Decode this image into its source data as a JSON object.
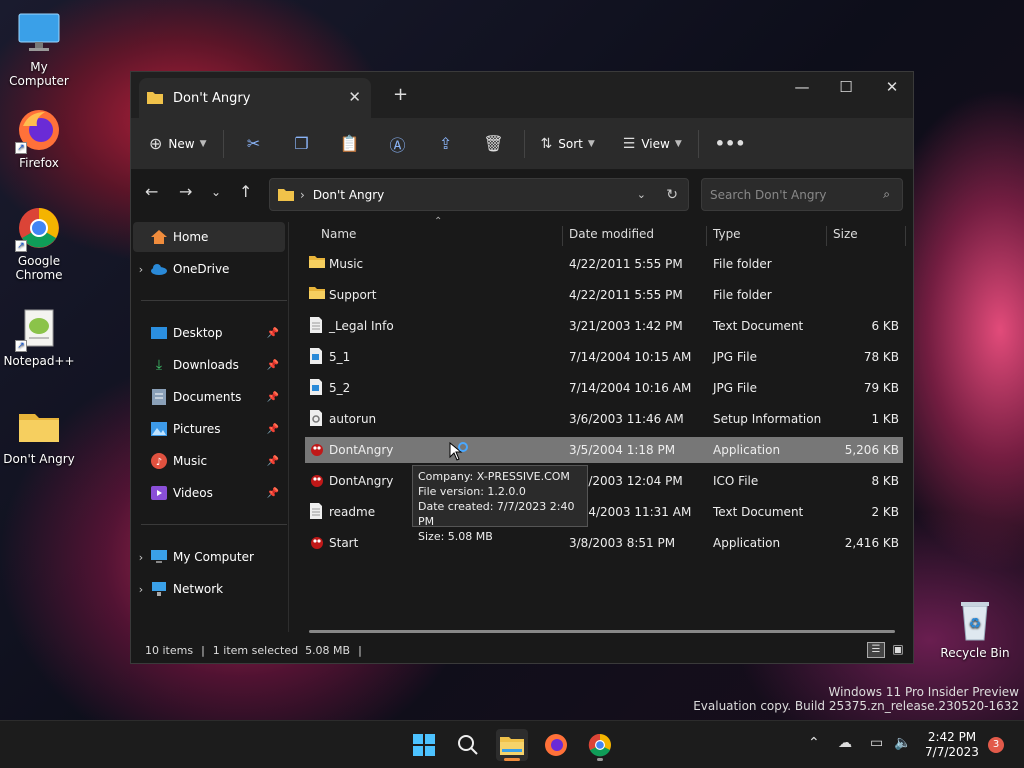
{
  "desktop": {
    "icons": [
      {
        "label": "My Computer"
      },
      {
        "label": "Firefox"
      },
      {
        "label": "Google Chrome"
      },
      {
        "label": "Notepad++"
      },
      {
        "label": "Don't Angry"
      },
      {
        "label": "Recycle Bin"
      }
    ],
    "watermark_line1": "Windows 11 Pro Insider Preview",
    "watermark_line2": "Evaluation copy. Build 25375.zn_release.230520-1632"
  },
  "window": {
    "tab_title": "Don't Angry",
    "toolbar": {
      "new_label": "New",
      "sort_label": "Sort",
      "view_label": "View"
    },
    "address": {
      "path": "Don't Angry",
      "search_placeholder": "Search Don't Angry"
    },
    "nav": {
      "home": "Home",
      "onedrive": "OneDrive",
      "desktop": "Desktop",
      "downloads": "Downloads",
      "documents": "Documents",
      "pictures": "Pictures",
      "music": "Music",
      "videos": "Videos",
      "mycomputer": "My Computer",
      "network": "Network"
    },
    "columns": {
      "name": "Name",
      "date": "Date modified",
      "type": "Type",
      "size": "Size"
    },
    "files": [
      {
        "name": "Music",
        "date": "4/22/2011 5:55 PM",
        "type": "File folder",
        "size": "",
        "icon": "folder-icon"
      },
      {
        "name": "Support",
        "date": "4/22/2011 5:55 PM",
        "type": "File folder",
        "size": "",
        "icon": "folder-icon"
      },
      {
        "name": "_Legal Info",
        "date": "3/21/2003 1:42 PM",
        "type": "Text Document",
        "size": "6 KB",
        "icon": "text-file-icon"
      },
      {
        "name": "5_1",
        "date": "7/14/2004 10:15 AM",
        "type": "JPG File",
        "size": "78 KB",
        "icon": "image-file-icon"
      },
      {
        "name": "5_2",
        "date": "7/14/2004 10:16 AM",
        "type": "JPG File",
        "size": "79 KB",
        "icon": "image-file-icon"
      },
      {
        "name": "autorun",
        "date": "3/6/2003 11:46 AM",
        "type": "Setup Information",
        "size": "1 KB",
        "icon": "setup-file-icon"
      },
      {
        "name": "DontAngry",
        "date": "3/5/2004 1:18 PM",
        "type": "Application",
        "size": "5,206 KB",
        "icon": "app-icon"
      },
      {
        "name": "DontAngry",
        "date": "3/5/2003 12:04 PM",
        "type": "ICO File",
        "size": "8 KB",
        "icon": "app-icon"
      },
      {
        "name": "readme",
        "date": "3/14/2003 11:31 AM",
        "type": "Text Document",
        "size": "2 KB",
        "icon": "text-file-icon"
      },
      {
        "name": "Start",
        "date": "3/8/2003 8:51 PM",
        "type": "Application",
        "size": "2,416 KB",
        "icon": "app-icon"
      }
    ],
    "tooltip": {
      "company": "Company: X-PRESSIVE.COM",
      "version": "File version: 1.2.0.0",
      "created": "Date created: 7/7/2023 2:40 PM",
      "size": "Size: 5.08 MB"
    },
    "status": {
      "count": "10 items",
      "selected": "1 item selected  5.08 MB"
    }
  },
  "taskbar": {
    "time": "2:42 PM",
    "date": "7/7/2023",
    "notification_count": "3"
  },
  "colors": {
    "accent": "#4cc2ff",
    "folder": "#f0c24a",
    "selection": "#777777"
  }
}
